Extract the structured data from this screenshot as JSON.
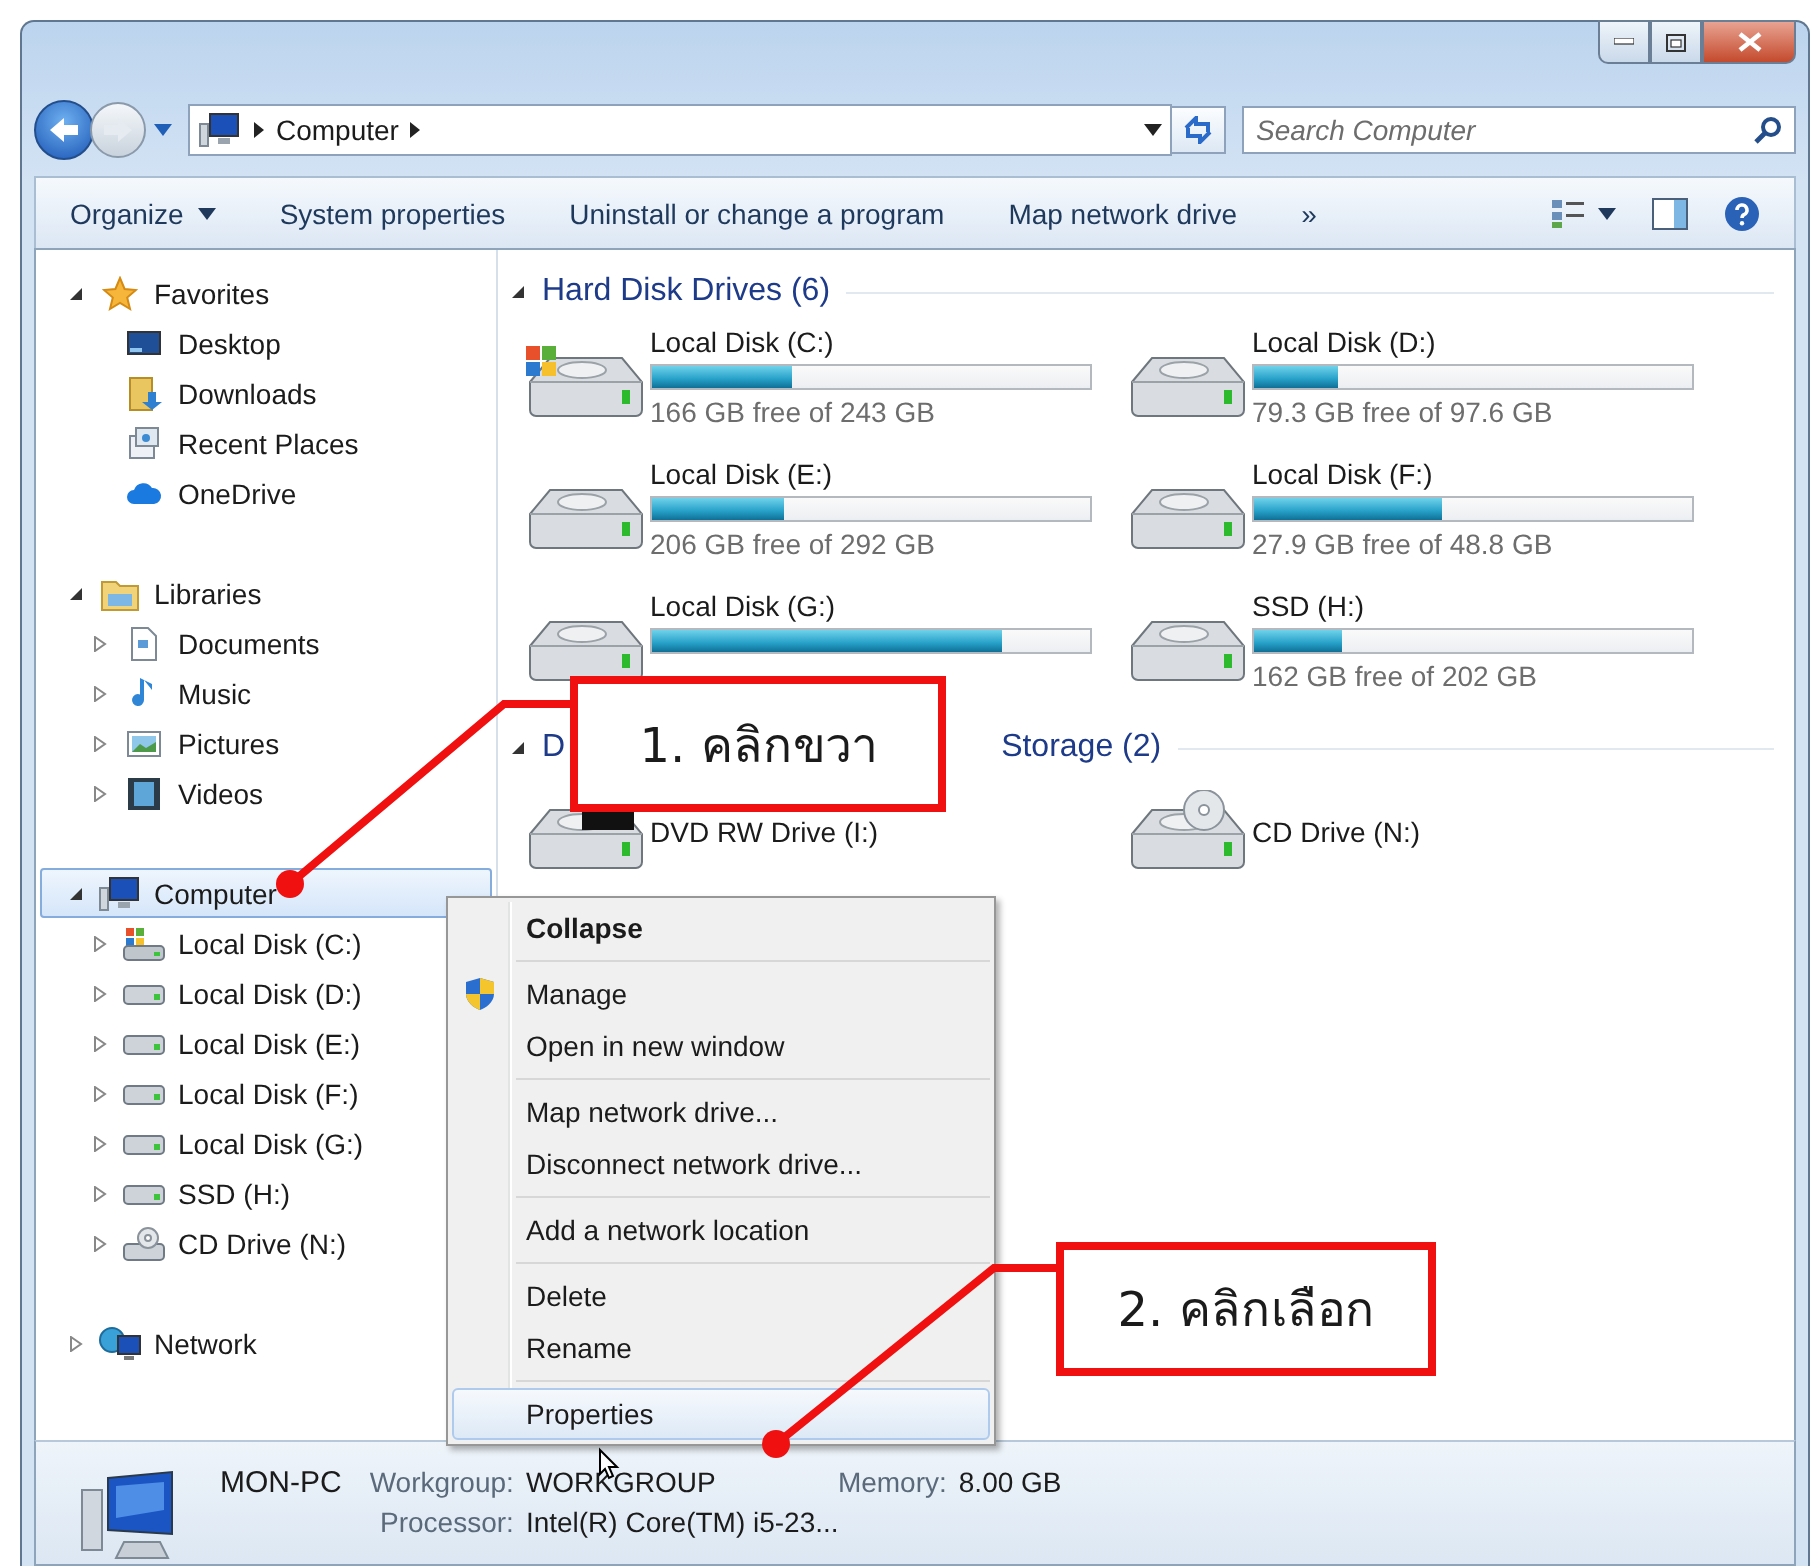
{
  "navigation": {
    "address": "Computer",
    "search_placeholder": "Search Computer"
  },
  "toolbar": [
    {
      "label": "Organize",
      "dropdown": true
    },
    {
      "label": "System properties",
      "dropdown": false
    },
    {
      "label": "Uninstall or change a program",
      "dropdown": false
    },
    {
      "label": "Map network drive",
      "dropdown": false
    },
    {
      "label": "»",
      "dropdown": false
    }
  ],
  "sidebar": [
    {
      "label": "Favorites",
      "kind": "star",
      "expanded": true,
      "selected": false,
      "children": [
        {
          "label": "Desktop",
          "kind": "desktop",
          "selected": false
        },
        {
          "label": "Downloads",
          "kind": "downloads",
          "selected": false
        },
        {
          "label": "Recent Places",
          "kind": "recent",
          "selected": false
        },
        {
          "label": "OneDrive",
          "kind": "cloud",
          "selected": false
        }
      ]
    },
    {
      "label": "Libraries",
      "kind": "library",
      "expanded": true,
      "selected": false,
      "children": [
        {
          "label": "Documents",
          "kind": "document",
          "expanded": false,
          "selected": false
        },
        {
          "label": "Music",
          "kind": "music",
          "expanded": false,
          "selected": false
        },
        {
          "label": "Pictures",
          "kind": "pictures",
          "expanded": false,
          "selected": false
        },
        {
          "label": "Videos",
          "kind": "videos",
          "expanded": false,
          "selected": false
        }
      ]
    },
    {
      "label": "Computer",
      "kind": "computer",
      "expanded": true,
      "selected": true,
      "children": [
        {
          "label": "Local Disk (C:)",
          "kind": "system",
          "expanded": false,
          "selected": false
        },
        {
          "label": "Local Disk (D:)",
          "kind": "disk",
          "expanded": false,
          "selected": false
        },
        {
          "label": "Local Disk (E:)",
          "kind": "disk",
          "expanded": false,
          "selected": false
        },
        {
          "label": "Local Disk (F:)",
          "kind": "disk",
          "expanded": false,
          "selected": false
        },
        {
          "label": "Local Disk (G:)",
          "kind": "disk",
          "expanded": false,
          "selected": false
        },
        {
          "label": "SSD (H:)",
          "kind": "disk",
          "expanded": false,
          "selected": false
        },
        {
          "label": "CD Drive (N:)",
          "kind": "cd",
          "expanded": false,
          "selected": false
        }
      ]
    },
    {
      "label": "Network",
      "kind": "network",
      "expanded": false,
      "selected": false
    }
  ],
  "hard_disk_drives": {
    "heading": "Hard Disk Drives (6)",
    "drives": [
      {
        "name": "Local Disk (C:)",
        "kind": "system",
        "level": 0.32,
        "free": "166 GB free of 243 GB"
      },
      {
        "name": "Local Disk (D:)",
        "kind": "disk",
        "level": 0.19,
        "free": "79.3 GB free of 97.6 GB"
      },
      {
        "name": "Local Disk (E:)",
        "kind": "disk",
        "level": 0.3,
        "free": "206 GB free of 292 GB"
      },
      {
        "name": "Local Disk (F:)",
        "kind": "disk",
        "level": 0.43,
        "free": "27.9 GB free of 48.8 GB"
      },
      {
        "name": "Local Disk (G:)",
        "kind": "disk",
        "level": 0.8
      },
      {
        "name": "SSD (H:)",
        "kind": "disk",
        "level": 0.2,
        "free": "162 GB free of 202 GB"
      }
    ]
  },
  "removable_storage": {
    "heading_start": "D",
    "heading_end": "Storage (2)",
    "drives": [
      {
        "name": "DVD RW Drive (I:)",
        "kind": "dvd"
      },
      {
        "name": "CD Drive (N:)",
        "kind": "cd"
      }
    ]
  },
  "context_menu": [
    [
      {
        "label": "Collapse",
        "kind": "default",
        "selected": false
      }
    ],
    [
      {
        "label": "Manage",
        "kind": "shield",
        "selected": false
      },
      {
        "label": "Open in new window",
        "kind": "plain",
        "selected": false
      }
    ],
    [
      {
        "label": "Map network drive...",
        "kind": "plain",
        "selected": false
      },
      {
        "label": "Disconnect network drive...",
        "kind": "plain",
        "selected": false
      }
    ],
    [
      {
        "label": "Add a network location",
        "kind": "plain",
        "selected": false
      }
    ],
    [
      {
        "label": "Delete",
        "kind": "plain",
        "selected": false
      },
      {
        "label": "Rename",
        "kind": "plain",
        "selected": false
      }
    ],
    [
      {
        "label": "Properties",
        "kind": "plain",
        "selected": true
      }
    ]
  ],
  "status_bar": {
    "name": "MON-PC",
    "fields": [
      {
        "label": "Workgroup:",
        "value": "WORKGROUP"
      },
      {
        "label": "Memory:",
        "value": "8.00 GB"
      },
      {
        "label": "Processor:",
        "value": "Intel(R) Core(TM) i5-23..."
      }
    ]
  },
  "callouts": [
    {
      "text": "1. คลิกขวา"
    },
    {
      "text": "2. คลิกเลือก"
    }
  ]
}
